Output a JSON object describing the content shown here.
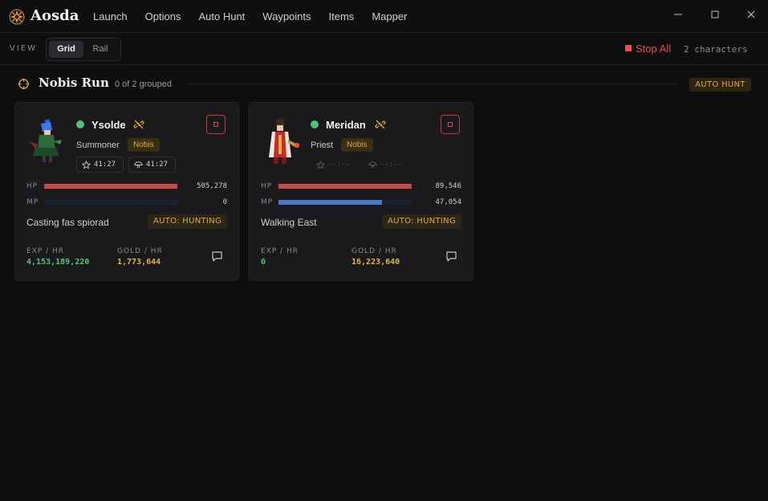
{
  "app": {
    "title": "Aosda",
    "menu": [
      "Launch",
      "Options",
      "Auto Hunt",
      "Waypoints",
      "Items",
      "Mapper"
    ]
  },
  "toolbar": {
    "view_label": "VIEW",
    "view_options": [
      "Grid",
      "Rail"
    ],
    "selected_view": "Grid",
    "stop_all_label": "Stop All",
    "character_count": "2 characters"
  },
  "group": {
    "title": "Nobis Run",
    "subtitle": "0 of 2 grouped",
    "mode_badge": "AUTO HUNT"
  },
  "characters": [
    {
      "name": "Ysolde",
      "class": "Summoner",
      "map": "Nobis",
      "timer_star": "41:27",
      "timer_fungus": "41:27",
      "hp_label": "HP",
      "hp": "505,278",
      "hp_fraction": 1.0,
      "mp_label": "MP",
      "mp": "0",
      "mp_fraction": 0.0,
      "activity": "Casting fas spiorad",
      "state": "AUTO: HUNTING",
      "exp_label": "EXP / HR",
      "exp_per_hr": "4,153,189,220",
      "gold_label": "GOLD / HR",
      "gold_per_hr": "1,773,644"
    },
    {
      "name": "Meridan",
      "class": "Priest",
      "map": "Nobis",
      "timer_star": "--:--",
      "timer_fungus": "--:--",
      "hp_label": "HP",
      "hp": "89,546",
      "hp_fraction": 1.0,
      "mp_label": "MP",
      "mp": "47,054",
      "mp_fraction": 0.78,
      "activity": "Walking East",
      "state": "AUTO: HUNTING",
      "exp_label": "EXP / HR",
      "exp_per_hr": "0",
      "gold_label": "GOLD / HR",
      "gold_per_hr": "16,223,640"
    }
  ],
  "colors": {
    "accent_gold": "#e2a73a",
    "hp_bar": "#c94a4a",
    "mp_bar": "#4a78c9",
    "online": "#4dc47b",
    "stop_red": "#ef4b4b"
  }
}
